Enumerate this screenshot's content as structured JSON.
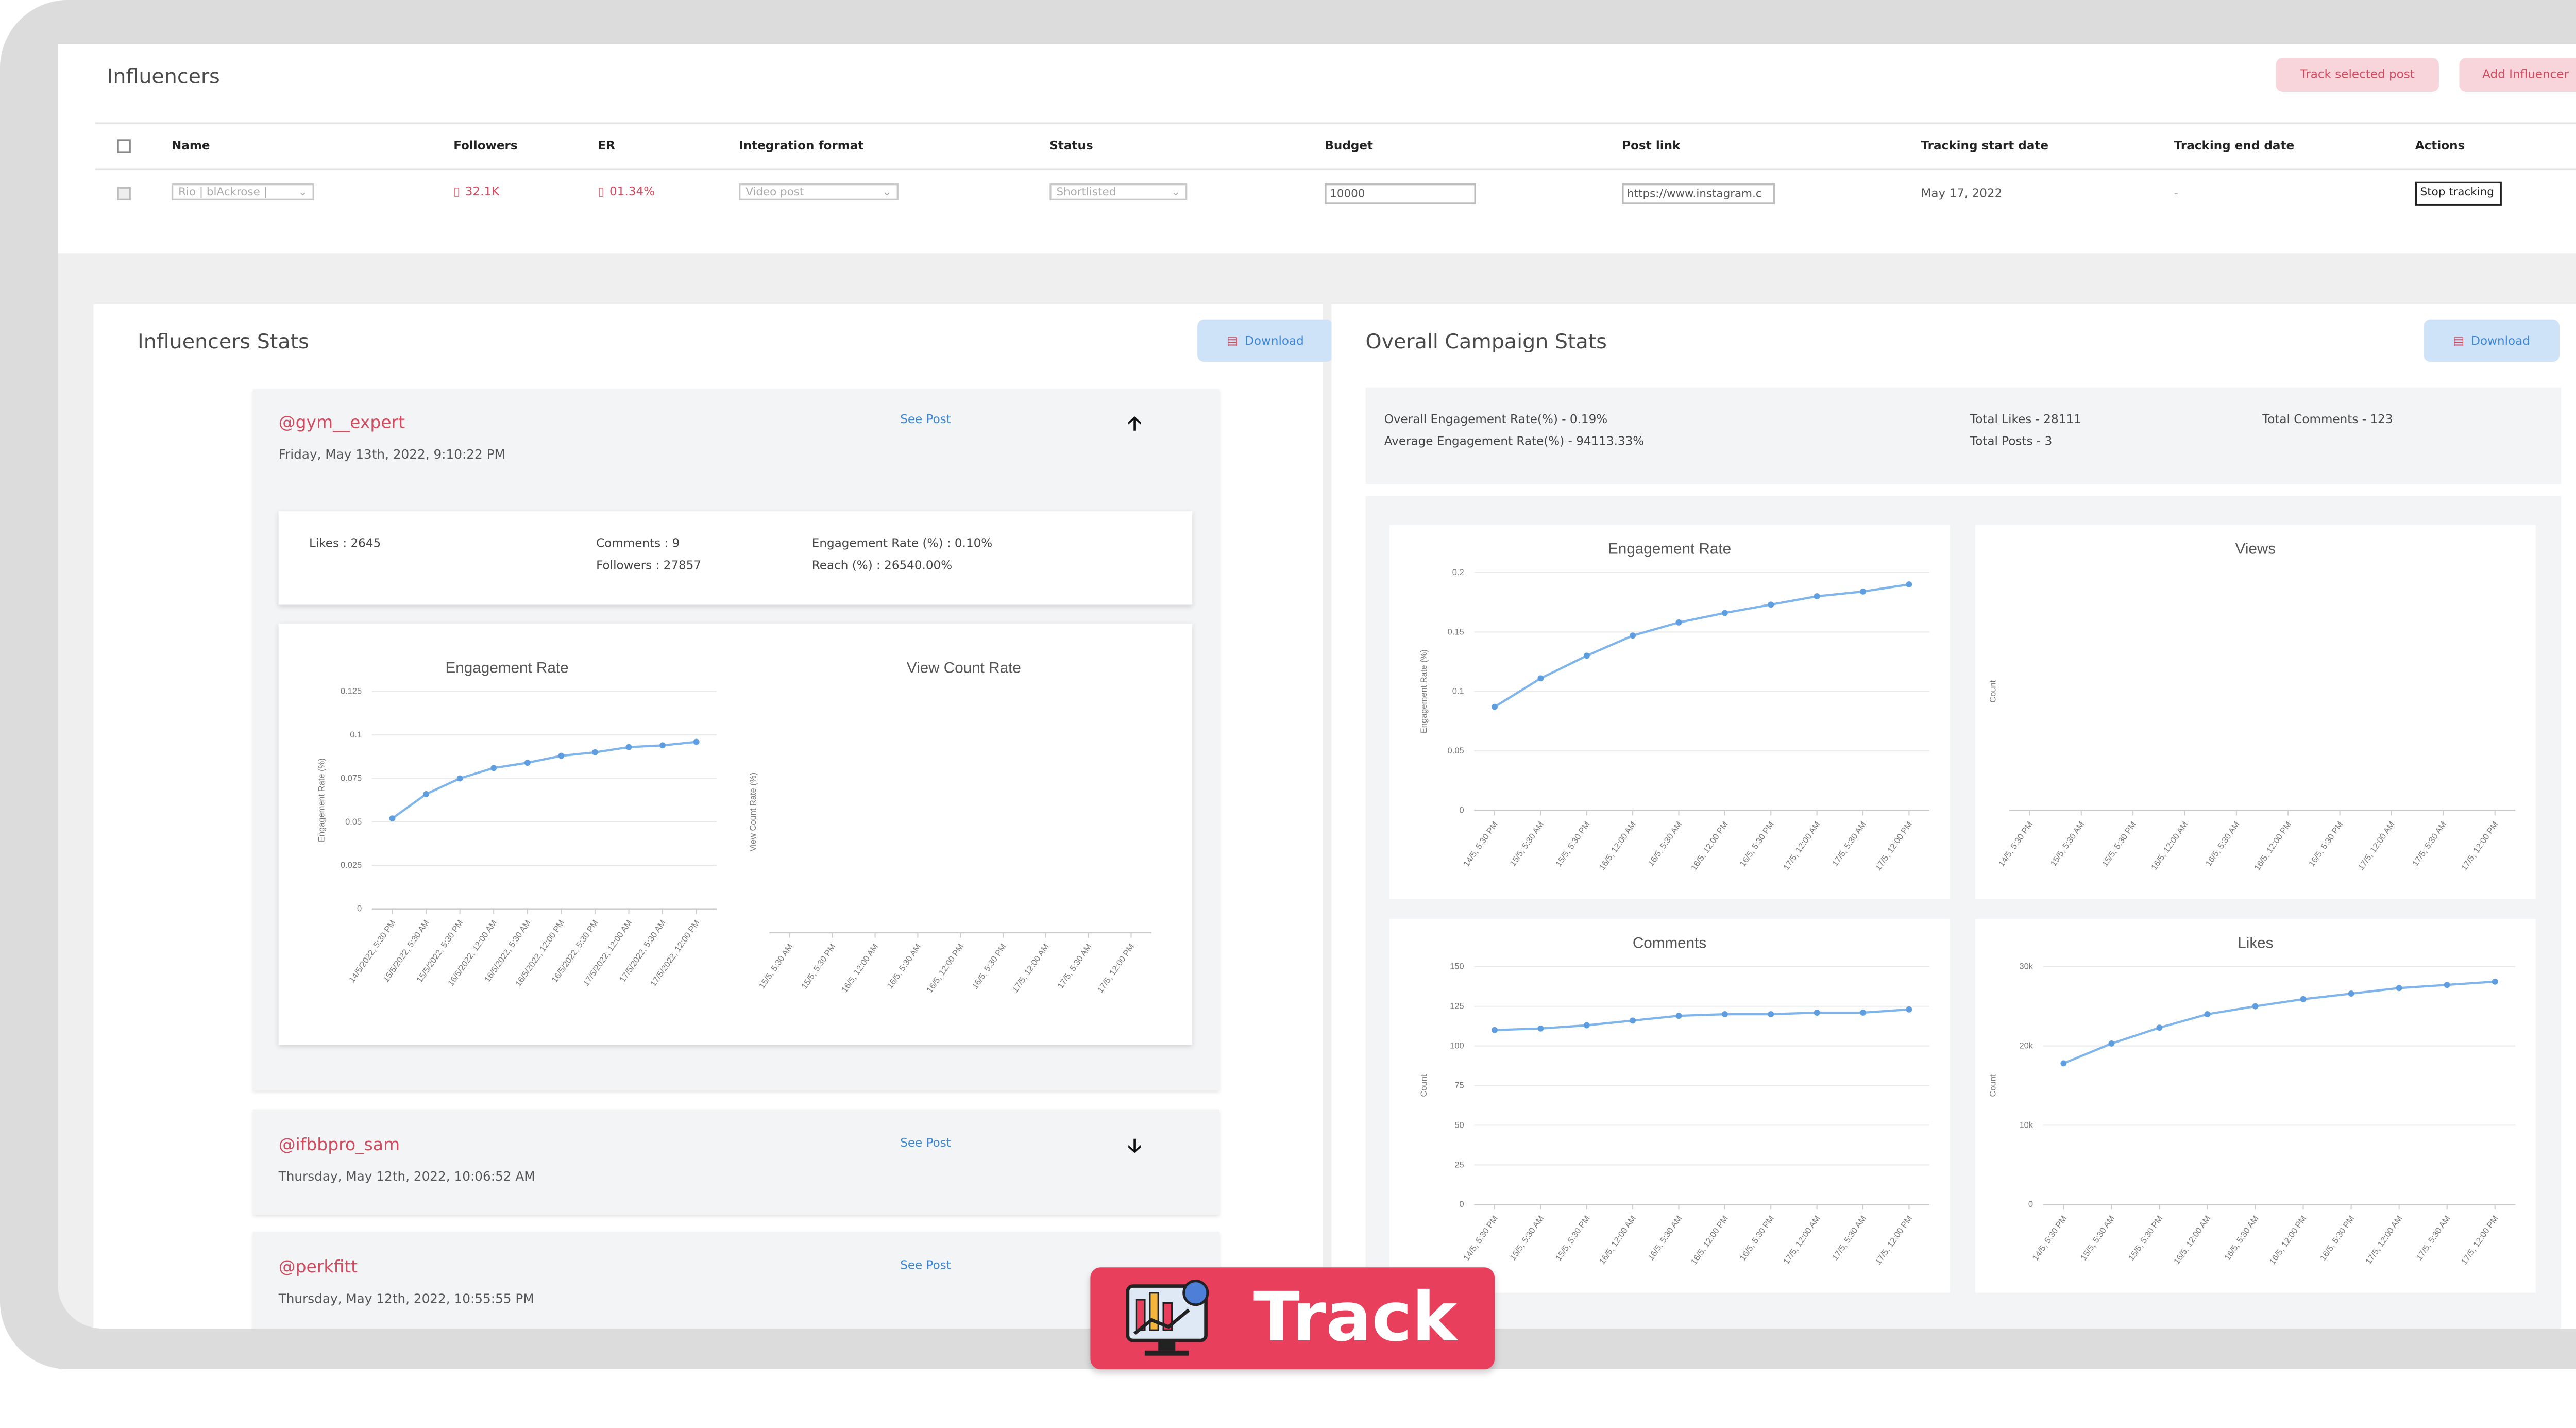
{
  "influencers": {
    "title": "Influencers",
    "track_selected_label": "Track selected post",
    "add_influencer_label": "Add Influencer",
    "columns": [
      "Name",
      "Followers",
      "ER",
      "Integration format",
      "Status",
      "Budget",
      "Post link",
      "Tracking start date",
      "Tracking end date",
      "Actions"
    ],
    "row": {
      "name": "Rio | blAckrose |",
      "followers": "32.1K",
      "er": "01.34%",
      "integration": "Video post",
      "status": "Shortlisted",
      "budget": "10000",
      "post_link": "https://www.instagram.c",
      "start_date": "May 17, 2022",
      "end_date": "-",
      "action": "Stop tracking"
    }
  },
  "influencer_stats": {
    "title": "Influencers Stats",
    "download_label": "Download",
    "posts": [
      {
        "handle": "@gym__expert",
        "date": "Friday, May 13th, 2022, 9:10:22 PM",
        "see_post": "See Post"
      },
      {
        "handle": "@ifbbpro_sam",
        "date": "Thursday, May 12th, 2022, 10:06:52 AM",
        "see_post": "See Post"
      },
      {
        "handle": "@perkfitt",
        "date": "Thursday, May 12th, 2022, 10:55:55 PM",
        "see_post": "See Post"
      }
    ],
    "metrics": {
      "likes": "Likes : 2645",
      "comments": "Comments : 9",
      "followers": "Followers : 27857",
      "engagement": "Engagement Rate (%) : 0.10%",
      "reach": "Reach (%) : 26540.00%"
    }
  },
  "overall": {
    "title": "Overall Campaign Stats",
    "download_label": "Download",
    "overall_er": "Overall Engagement Rate(%) - 0.19%",
    "avg_er": "Average Engagement Rate(%) - 94113.33%",
    "total_likes": "Total Likes - 28111",
    "total_posts": "Total Posts - 3",
    "total_comments": "Total Comments - 123"
  },
  "chart_data": [
    {
      "type": "line",
      "title": "Engagement Rate",
      "ylabel": "Engagement Rate (%)",
      "categories": [
        "14/5/2022, 5:30 PM",
        "15/5/2022, 5:30 AM",
        "15/5/2022, 5:30 PM",
        "16/5/2022, 12:00 AM",
        "16/5/2022, 5:30 AM",
        "16/5/2022, 12:00 PM",
        "16/5/2022, 5:30 PM",
        "17/5/2022, 12:00 AM",
        "17/5/2022, 5:30 AM",
        "17/5/2022, 12:00 PM"
      ],
      "values": [
        0.052,
        0.066,
        0.075,
        0.081,
        0.084,
        0.088,
        0.09,
        0.093,
        0.094,
        0.096
      ],
      "ylim": [
        0,
        0.125
      ],
      "yticks": [
        "0",
        "0.025",
        "0.05",
        "0.075",
        "0.1",
        "0.125"
      ]
    },
    {
      "type": "line",
      "title": "View Count Rate",
      "ylabel": "View Count Rate (%)",
      "categories": [
        "15/5, 5:30 AM",
        "15/5, 5:30 PM",
        "16/5, 12:00 AM",
        "16/5, 5:30 AM",
        "16/5, 12:00 PM",
        "16/5, 5:30 PM",
        "17/5, 12:00 AM",
        "17/5, 5:30 AM",
        "17/5, 12:00 PM"
      ],
      "values": []
    },
    {
      "type": "line",
      "title": "Engagement Rate",
      "ylabel": "Engagement Rate (%)",
      "categories": [
        "14/5, 5:30 PM",
        "15/5, 5:30 AM",
        "15/5, 5:30 PM",
        "16/5, 12:00 AM",
        "16/5, 5:30 AM",
        "16/5, 12:00 PM",
        "16/5, 5:30 PM",
        "17/5, 12:00 AM",
        "17/5, 5:30 AM",
        "17/5, 12:00 PM"
      ],
      "values": [
        0.087,
        0.111,
        0.13,
        0.147,
        0.158,
        0.166,
        0.173,
        0.18,
        0.184,
        0.19
      ],
      "ylim": [
        0,
        0.2
      ],
      "yticks": [
        "0",
        "0.05",
        "0.1",
        "0.15",
        "0.2"
      ]
    },
    {
      "type": "line",
      "title": "Views",
      "ylabel": "Count",
      "categories": [
        "14/5, 5:30 PM",
        "15/5, 5:30 AM",
        "15/5, 5:30 PM",
        "16/5, 12:00 AM",
        "16/5, 5:30 AM",
        "16/5, 12:00 PM",
        "16/5, 5:30 PM",
        "17/5, 12:00 AM",
        "17/5, 5:30 AM",
        "17/5, 12:00 PM"
      ],
      "values": []
    },
    {
      "type": "line",
      "title": "Comments",
      "ylabel": "Count",
      "categories": [
        "14/5, 5:30 PM",
        "15/5, 5:30 AM",
        "15/5, 5:30 PM",
        "16/5, 12:00 AM",
        "16/5, 5:30 AM",
        "16/5, 12:00 PM",
        "16/5, 5:30 PM",
        "17/5, 12:00 AM",
        "17/5, 5:30 AM",
        "17/5, 12:00 PM"
      ],
      "values": [
        110,
        111,
        113,
        116,
        119,
        120,
        120,
        121,
        121,
        123
      ],
      "ylim": [
        0,
        150
      ],
      "yticks": [
        "0",
        "25",
        "50",
        "75",
        "100",
        "125",
        "150"
      ]
    },
    {
      "type": "line",
      "title": "Likes",
      "ylabel": "Count",
      "categories": [
        "14/5, 5:30 PM",
        "15/5, 5:30 AM",
        "15/5, 5:30 PM",
        "16/5, 12:00 AM",
        "16/5, 5:30 AM",
        "16/5, 12:00 PM",
        "16/5, 5:30 PM",
        "17/5, 12:00 AM",
        "17/5, 5:30 AM",
        "17/5, 12:00 PM"
      ],
      "values": [
        17800,
        20300,
        22300,
        24000,
        25000,
        25900,
        26600,
        27300,
        27700,
        28111
      ],
      "ylim": [
        0,
        30000
      ],
      "yticks": [
        "0",
        "10k",
        "20k",
        "30k"
      ]
    }
  ],
  "badge": {
    "label": "Track"
  },
  "colors": {
    "accent": "#e8405c",
    "line": "#7fb5ea",
    "link": "#3d86d6",
    "handle": "#d24a5e"
  }
}
